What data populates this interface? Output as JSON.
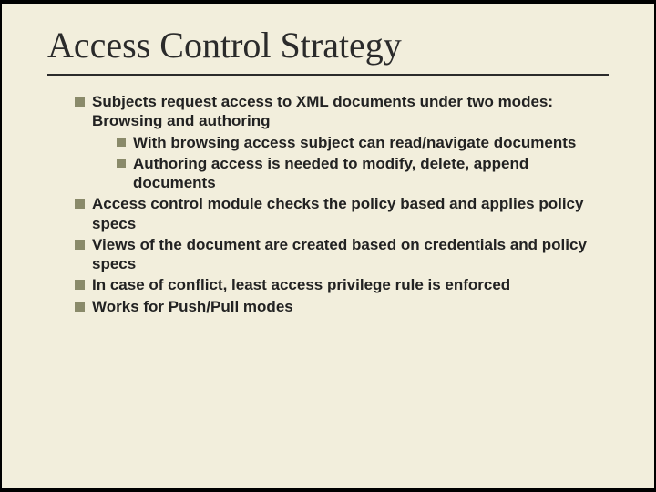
{
  "title": "Access Control Strategy",
  "bullets": {
    "b1": "Subjects request access to XML documents under two modes: Browsing and authoring",
    "b1a": "With browsing access subject can read/navigate documents",
    "b1b": "Authoring access is needed to modify, delete, append documents",
    "b2": "Access control module checks the policy based and applies policy specs",
    "b3": "Views of the document are created based on credentials and policy specs",
    "b4": "In case of conflict, least access privilege rule is enforced",
    "b5": "Works for Push/Pull modes"
  }
}
